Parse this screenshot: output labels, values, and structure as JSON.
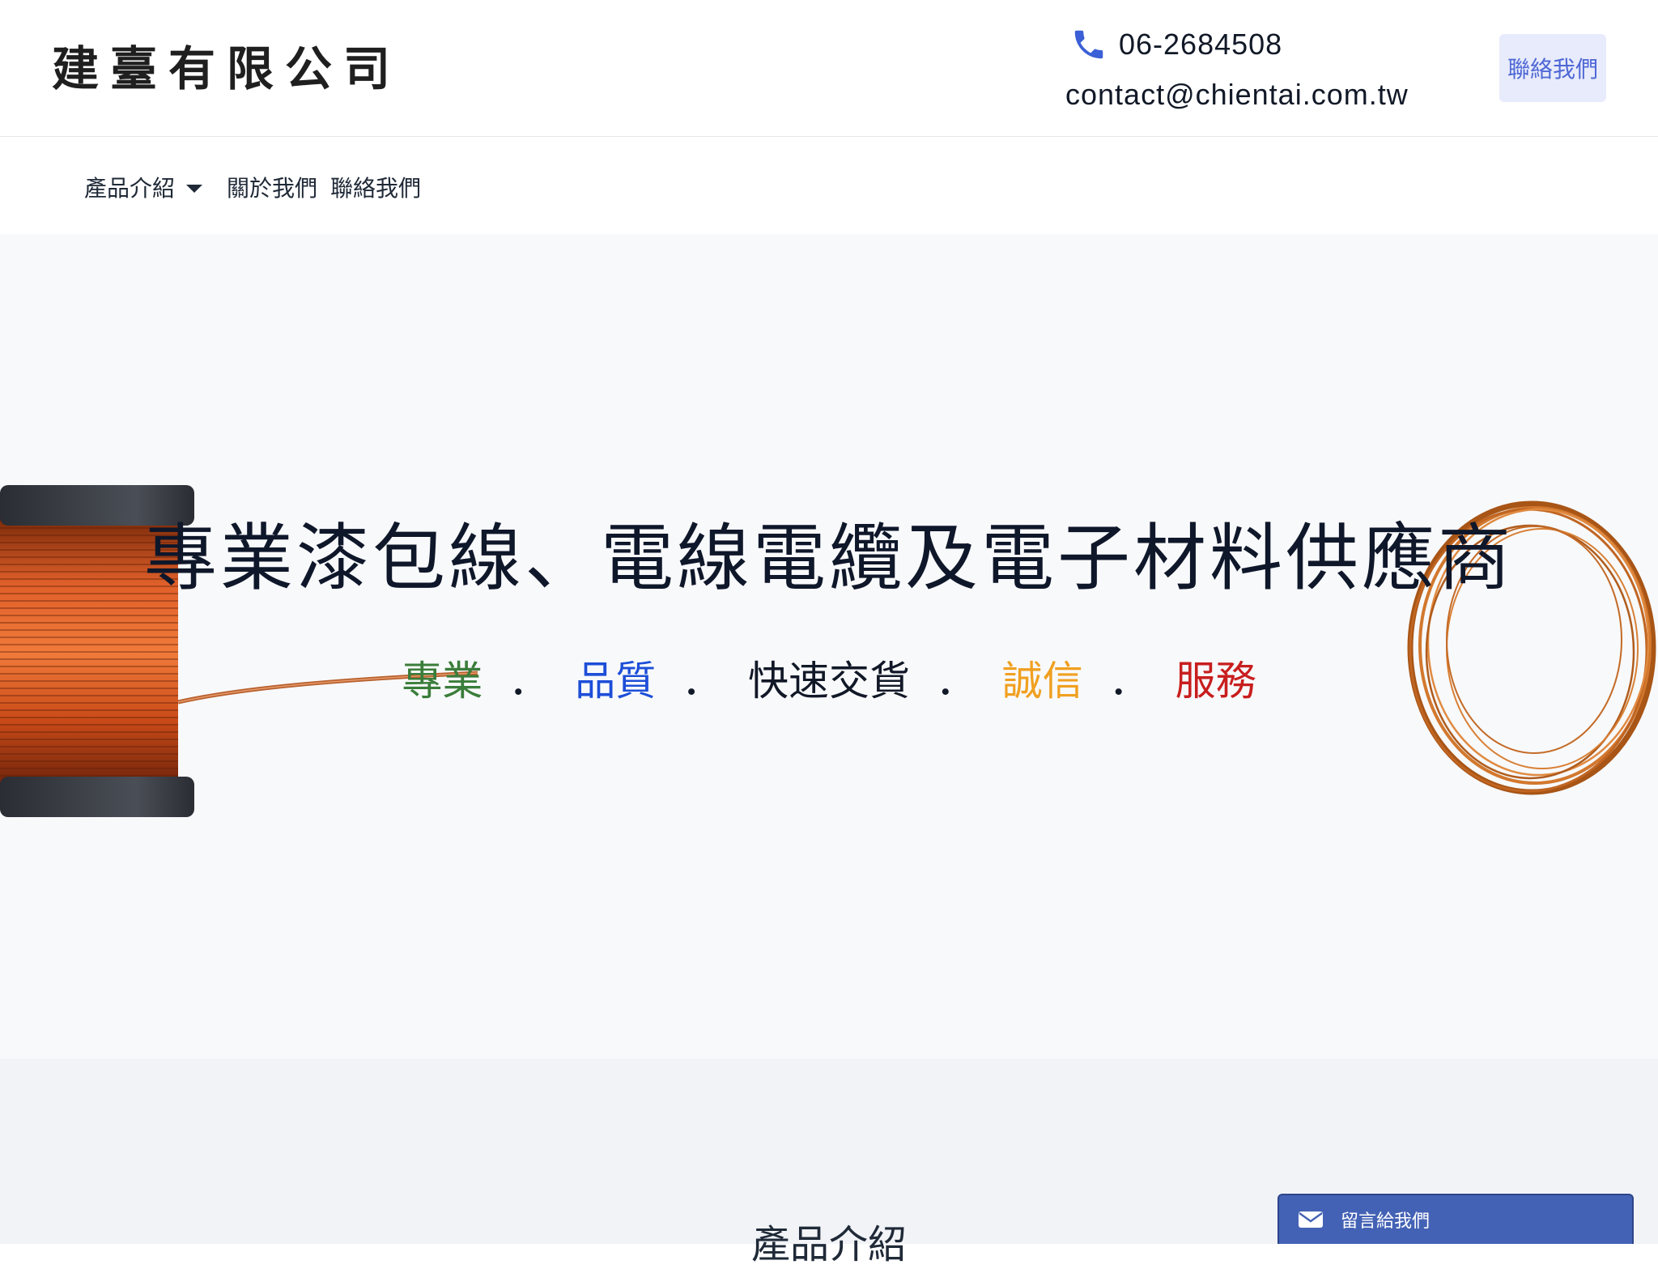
{
  "header": {
    "logo_text": "建臺有限公司",
    "phone": "06-2684508",
    "email": "contact@chientai.com.tw",
    "contact_button": "聯絡我們",
    "phone_icon": "phone-icon",
    "accent_color": "#3b5fd6"
  },
  "nav": {
    "items": [
      {
        "label": "產品介紹",
        "has_dropdown": true
      },
      {
        "label": "關於我們"
      },
      {
        "label": "聯絡我們"
      }
    ]
  },
  "hero": {
    "title": "專業漆包線、電線電纜及電子材料供應商",
    "subtitle_words": [
      {
        "text": "專業",
        "color": "#3a7d3a"
      },
      {
        "text": "．"
      },
      {
        "text": "品質",
        "color": "#1d4ed8"
      },
      {
        "text": "．"
      },
      {
        "text": "快速交貨",
        "color": "#111827"
      },
      {
        "text": "．"
      },
      {
        "text": "誠信",
        "color": "#f0a020"
      },
      {
        "text": "．"
      },
      {
        "text": "服務",
        "color": "#c81e1e"
      }
    ]
  },
  "section2": {
    "title": "產品介紹"
  },
  "message_bar": {
    "label": "留言給我們",
    "icon": "mail-icon",
    "color": "#4462b5"
  }
}
